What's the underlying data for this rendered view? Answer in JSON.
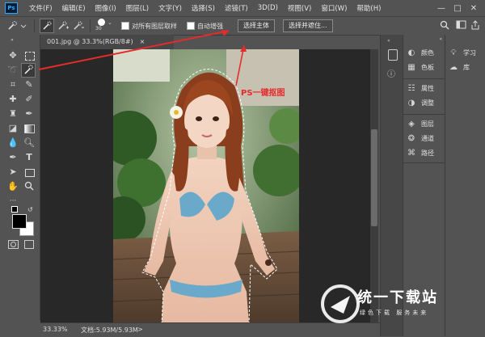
{
  "app": {
    "logo_text": "Ps"
  },
  "menu": [
    "文件(F)",
    "编辑(E)",
    "图像(I)",
    "图层(L)",
    "文字(Y)",
    "选择(S)",
    "滤镜(T)",
    "3D(D)",
    "视图(V)",
    "窗口(W)",
    "帮助(H)"
  ],
  "window_controls": {
    "minimize": "—",
    "maximize": "□",
    "close": "✕"
  },
  "options": {
    "brush_size": "30",
    "sample_all_layers": "对所有图层取样",
    "auto_enhance": "自动增强",
    "select_subject": "选择主体",
    "select_and_mask": "选择并遮住..."
  },
  "document": {
    "tab_title": "001.jpg @ 33.3%(RGB/8#)",
    "tab_close": "×",
    "zoom": "33.33%",
    "doc_info": "文档:5.93M/5.93M",
    "status_arrow": ">"
  },
  "annotation": "PS一键抠图",
  "panels": {
    "left_group": [
      "颜色",
      "色板",
      "属性",
      "调整",
      "图层",
      "通道",
      "路径"
    ],
    "right_group": [
      "学习",
      "库"
    ]
  },
  "watermark": {
    "title": "统一下载站",
    "subtitle": "绿色下载  服务未来"
  },
  "colors": {
    "accent_red": "#e52b2b",
    "chrome": "#535353",
    "pasteboard": "#282828"
  }
}
